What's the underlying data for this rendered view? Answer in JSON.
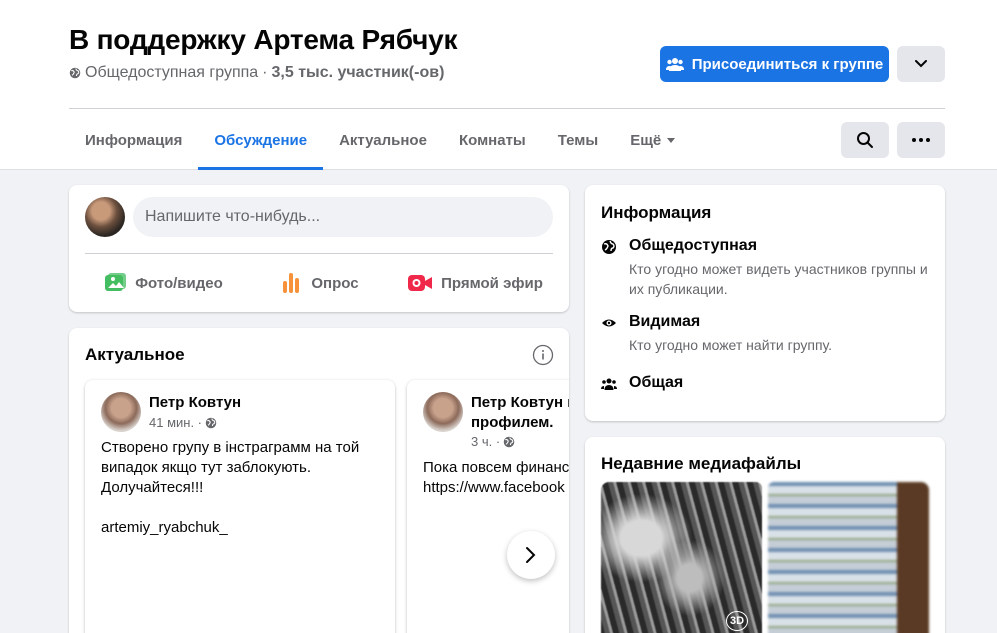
{
  "group": {
    "title": "В поддержку Артема Рябчук",
    "privacy": "Общедоступная группа",
    "separator": "·",
    "members": "3,5 тыс. участник(-ов)"
  },
  "header": {
    "join_label": "Присоединиться к группе"
  },
  "tabs": [
    {
      "label": "Информация"
    },
    {
      "label": "Обсуждение"
    },
    {
      "label": "Актуальное"
    },
    {
      "label": "Комнаты"
    },
    {
      "label": "Темы"
    },
    {
      "label": "Ещё"
    }
  ],
  "active_tab": "Обсуждение",
  "composer": {
    "placeholder": "Напишите что-нибудь...",
    "actions": [
      {
        "label": "Фото/видео",
        "icon": "photo-icon",
        "color": "#45bd62"
      },
      {
        "label": "Опрос",
        "icon": "poll-icon",
        "color": "#f7923b"
      },
      {
        "label": "Прямой эфир",
        "icon": "live-video-icon",
        "color": "#f02849"
      }
    ]
  },
  "featured": {
    "title": "Актуальное",
    "posts": [
      {
        "author": "Петр Ковтун",
        "time": "41 мин. ·",
        "text": "Створено групу в інстраграмм на той випадок якщо тут заблокують.\nДолучайтеся!!!\n\nartemiy_ryabchuk_"
      },
      {
        "author": "Петр Ковтун п",
        "author_line2": "профилем.",
        "time": "3 ч. ·",
        "text": "Пока повсем финанс вопросам:\nhttps://www.facebook"
      }
    ]
  },
  "about": {
    "title": "Информация",
    "items": [
      {
        "title": "Общедоступная",
        "desc": "Кто угодно может видеть участников группы и их публикации.",
        "icon": "globe-icon"
      },
      {
        "title": "Видимая",
        "desc": "Кто угодно может найти группу.",
        "icon": "eye-icon"
      },
      {
        "title": "Общая",
        "desc": "",
        "icon": "people-icon"
      }
    ]
  },
  "media": {
    "title": "Недавние медиафайлы",
    "badge": "3D"
  },
  "colors": {
    "accent": "#1b74e4",
    "secondary_button": "#e4e6eb",
    "page_bg": "#f0f2f5"
  }
}
